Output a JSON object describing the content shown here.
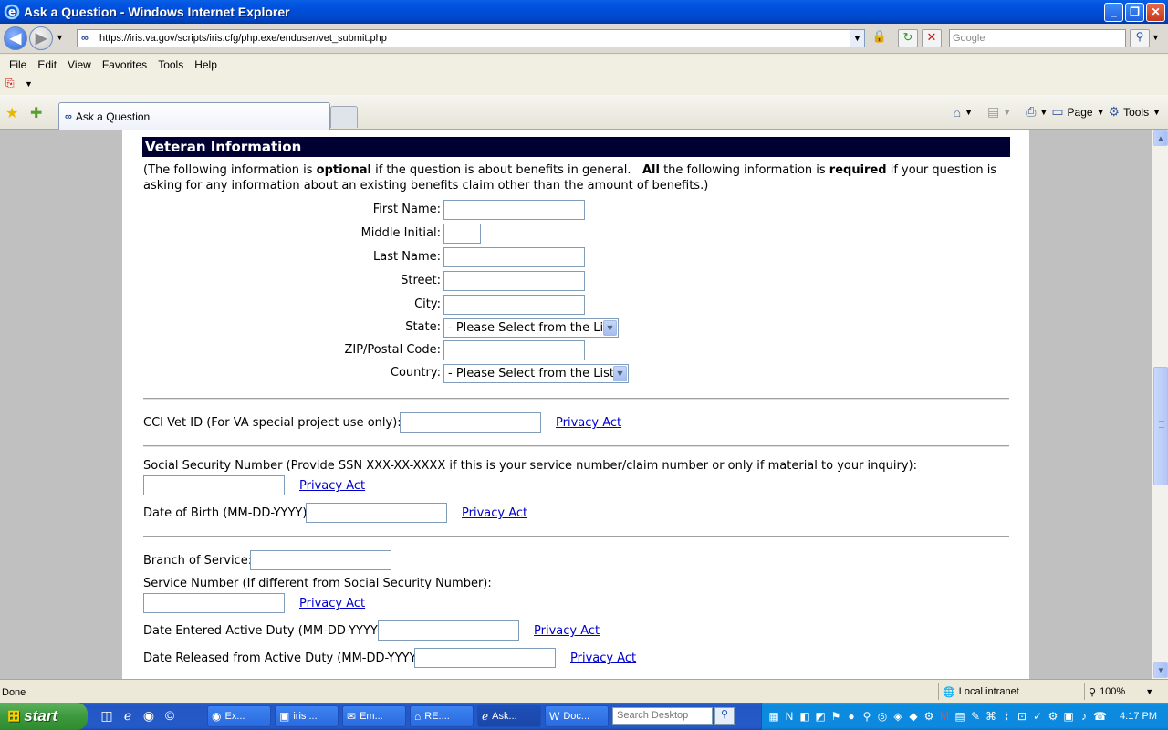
{
  "window": {
    "title": "Ask a Question - Windows Internet Explorer",
    "minimize_glyph": "_",
    "maximize_glyph": "❐",
    "close_glyph": "✕"
  },
  "address_bar": {
    "url": "https://iris.va.gov/scripts/iris.cfg/php.exe/enduser/vet_submit.php",
    "search_placeholder": "Google"
  },
  "menu": [
    "File",
    "Edit",
    "View",
    "Favorites",
    "Tools",
    "Help"
  ],
  "tab": {
    "label": "Ask a Question"
  },
  "command_bar": {
    "page_label": "Page",
    "tools_label": "Tools"
  },
  "form": {
    "section_title": "Veteran Information",
    "intro": {
      "part1": "(The following information is ",
      "optional": "optional",
      "part2": " if the question is about benefits in general.   ",
      "all": "All",
      "part3": " the following information is ",
      "required": "required",
      "part4": " if your question is asking for any information about an existing benefits claim other than the amount of benefits.)"
    },
    "first_name_label": "First Name:",
    "middle_initial_label": "Middle Initial:",
    "last_name_label": "Last Name:",
    "street_label": "Street:",
    "city_label": "City:",
    "state_label": "State:",
    "state_value": "- Please Select from the List",
    "zip_label": "ZIP/Postal Code:",
    "country_label": "Country:",
    "country_value": "- Please Select from the List",
    "cci_label": "CCI Vet ID (For VA special project use only):",
    "ssn_label": "Social Security Number (Provide SSN XXX-XX-XXXX if this is your service number/claim number or only if material to your inquiry):",
    "dob_label": "Date of Birth (MM-DD-YYYY):",
    "branch_label": "Branch of Service:",
    "service_number_label": "Service Number (If different from Social Security Number):",
    "date_entered_label": "Date Entered Active Duty (MM-DD-YYYY):",
    "date_released_label": "Date Released from Active Duty (MM-DD-YYYY):",
    "privacy_act": "Privacy Act"
  },
  "status_bar": {
    "status": "Done",
    "zone": "Local intranet",
    "zoom": "100%"
  },
  "taskbar": {
    "start": "start",
    "buttons": [
      "Ex...",
      "iris ...",
      "Em...",
      "RE:...",
      "Ask...",
      "Doc..."
    ],
    "search_placeholder": "Search Desktop",
    "clock": "4:17 PM"
  },
  "colors": {
    "section_header_bg": "#000033",
    "link": "#0000cc",
    "titlebar": "#0054e3",
    "taskbar": "#245ac8",
    "start_button": "#3c9a3c"
  }
}
